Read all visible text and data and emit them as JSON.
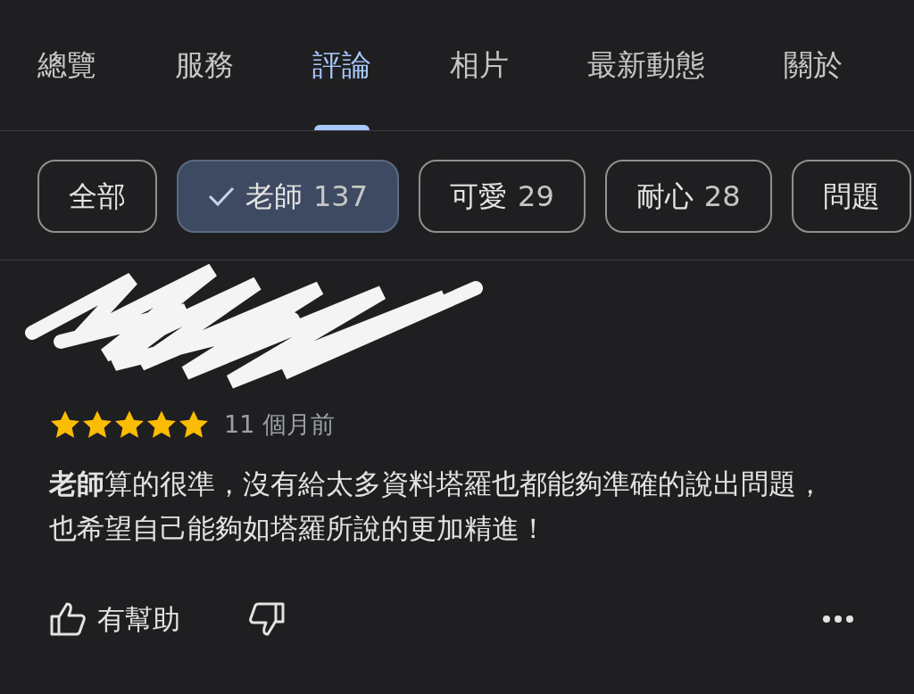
{
  "tabs": [
    {
      "label": "總覽",
      "selected": false
    },
    {
      "label": "服務",
      "selected": false
    },
    {
      "label": "評論",
      "selected": true
    },
    {
      "label": "相片",
      "selected": false
    },
    {
      "label": "最新動態",
      "selected": false
    },
    {
      "label": "關於",
      "selected": false
    }
  ],
  "filters": [
    {
      "label": "全部",
      "selected": false
    },
    {
      "label": "老師",
      "count": "137",
      "selected": true
    },
    {
      "label": "可愛",
      "count": "29",
      "selected": false
    },
    {
      "label": "耐心",
      "count": "28",
      "selected": false
    },
    {
      "label": "問題",
      "selected": false
    }
  ],
  "review": {
    "stars": 5,
    "time": "11 個月前",
    "text": "**老師**算的很準，沒有給太多資料塔羅也都能夠準確的說出問題，也希望自己能夠如塔羅所說的更加精進！",
    "helpful_label": "有幫助"
  }
}
